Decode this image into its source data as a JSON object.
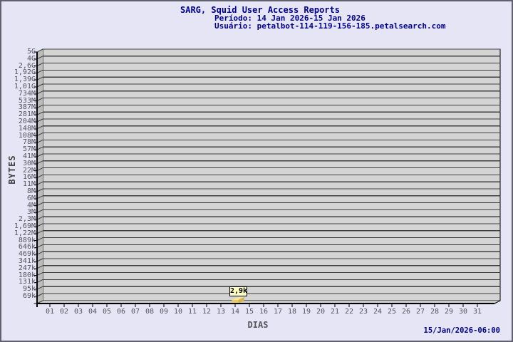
{
  "window": {
    "background_color": "#e5e5f6",
    "border_color": "#62626e"
  },
  "header": {
    "title": "SARG, Squid User Access Reports",
    "period": "Período: 14 Jan 2026-15 Jan 2026",
    "user": "Usuário: petalbot-114-119-156-185.petalsearch.com",
    "text_color": "#00008b"
  },
  "footer": {
    "timestamp": "15/Jan/2026-06:00"
  },
  "chart_data": {
    "type": "bar",
    "title": "SARG, Squid User Access Reports",
    "subtitle_period": "Período: 14 Jan 2026-15 Jan 2026",
    "subtitle_user": "Usuário: petalbot-114-119-156-185.petalsearch.com",
    "xlabel": "DIAS",
    "ylabel": "BYTES",
    "y_scale": "logarithmic",
    "y_tick_labels": [
      "5G",
      "4G",
      "2,6G",
      "1,92G",
      "1,39G",
      "1,01G",
      "734M",
      "533M",
      "387M",
      "281M",
      "204M",
      "148M",
      "108M",
      "78M",
      "57M",
      "41M",
      "30M",
      "22M",
      "16M",
      "11M",
      "8M",
      "6M",
      "4M",
      "3M",
      "2,3M",
      "1,69M",
      "1,22M",
      "889k",
      "646k",
      "469k",
      "341k",
      "247k",
      "180k",
      "131k",
      "95k",
      "69k"
    ],
    "x_tick_labels": [
      "01",
      "02",
      "03",
      "04",
      "05",
      "06",
      "07",
      "08",
      "09",
      "10",
      "11",
      "12",
      "13",
      "14",
      "15",
      "16",
      "17",
      "18",
      "19",
      "20",
      "21",
      "22",
      "23",
      "24",
      "25",
      "26",
      "27",
      "28",
      "29",
      "30",
      "31"
    ],
    "x_range": [
      1,
      31
    ],
    "grid": true,
    "bars": [
      {
        "day": "14",
        "label": "2,9k",
        "value_bytes": 2900
      }
    ],
    "colors": {
      "plot_background": "#d4d4d4",
      "left_face": "#bcbcbc",
      "floor": "#c9c9c9",
      "gridline": "#3f3f3f",
      "axis": "#000000",
      "bar_front": "#e9cb61",
      "bar_top": "#f4e49c",
      "bar_side": "#d4b44e",
      "annotation_background": "#ffffc2"
    }
  }
}
